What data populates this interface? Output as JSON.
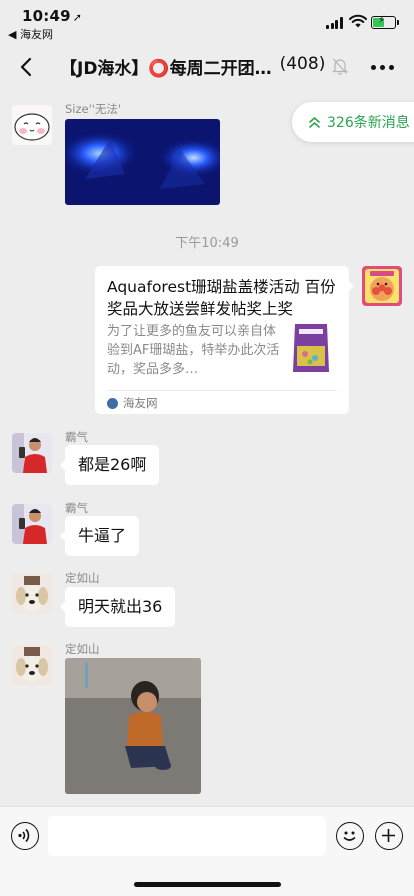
{
  "status_bar": {
    "time": "10:49",
    "back_app": "◀ 海友网"
  },
  "nav": {
    "title": "【JD海水】⭕每周二开团…",
    "count": "(408)"
  },
  "new_messages": {
    "label": "326条新消息"
  },
  "messages": [
    {
      "sender": "Size''无法'"
    },
    {
      "timestamp": "下午10:49"
    },
    {
      "card_title": "Aquaforest珊瑚盐盖楼活动 百份奖品大放送尝鲜发帖奖上奖",
      "card_desc": "为了让更多的鱼友可以亲自体验到AF珊瑚盐，特举办此次活动，奖品多多…",
      "card_source": "海友网"
    },
    {
      "sender": "霸气",
      "text": "都是26啊"
    },
    {
      "sender": "霸气",
      "text": "牛逼了"
    },
    {
      "sender": "定如山",
      "text": "明天就出36"
    },
    {
      "sender": "定如山"
    }
  ],
  "input": {
    "value": "",
    "placeholder": ""
  },
  "colors": {
    "accent_green": "#2aa44f",
    "background": "#ededed",
    "bubble": "#ffffff"
  },
  "icons": [
    "back-arrow-icon",
    "mute-bell-icon",
    "more-dots-icon",
    "voice-icon",
    "emoji-icon",
    "plus-icon",
    "double-chevron-up-icon"
  ]
}
